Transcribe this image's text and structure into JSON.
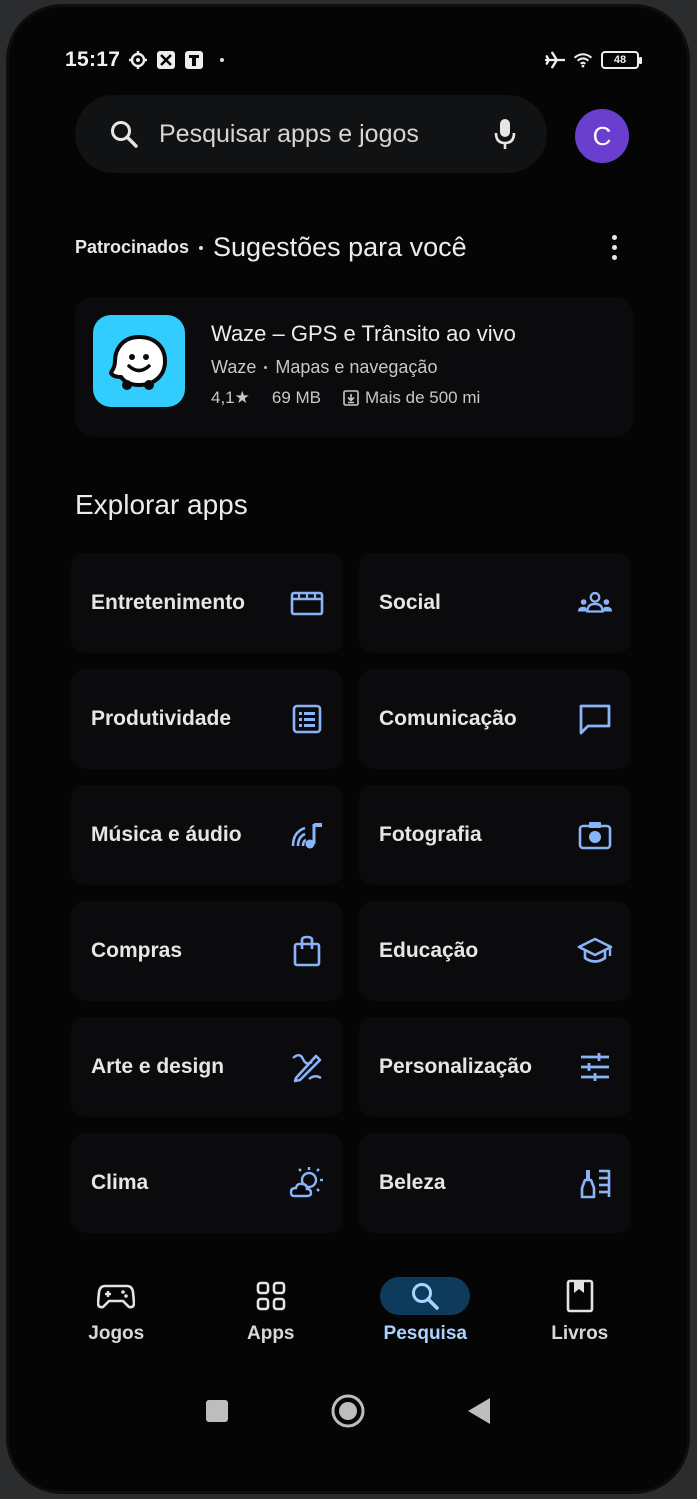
{
  "status_bar": {
    "time": "15:17",
    "battery": "48",
    "icons": [
      "settings-icon",
      "app-notification-icon",
      "app-notification-icon",
      "airplane-mode-icon",
      "wifi-icon",
      "battery-icon"
    ]
  },
  "search": {
    "placeholder": "Pesquisar apps e jogos",
    "search_icon": "search-icon",
    "mic_icon": "mic-icon"
  },
  "account": {
    "initial": "C",
    "color": "#6a3fd0"
  },
  "suggestions": {
    "sponsored_label": "Patrocinados",
    "title": "Sugestões para você",
    "app": {
      "name": "Waze – GPS e Trânsito ao vivo",
      "developer": "Waze",
      "category": "Mapas e navegação",
      "rating": "4,1★",
      "size": "69 MB",
      "downloads": "Mais de 500 mi",
      "icon_color": "#33ccff"
    }
  },
  "explore": {
    "title": "Explorar apps",
    "categories": [
      {
        "label": "Entretenimento",
        "icon": "clapperboard-icon"
      },
      {
        "label": "Social",
        "icon": "people-icon"
      },
      {
        "label": "Produtividade",
        "icon": "list-icon"
      },
      {
        "label": "Comunicação",
        "icon": "chat-icon"
      },
      {
        "label": "Música e áudio",
        "icon": "music-note-icon"
      },
      {
        "label": "Fotografia",
        "icon": "camera-icon"
      },
      {
        "label": "Compras",
        "icon": "shopping-bag-icon"
      },
      {
        "label": "Educação",
        "icon": "graduation-cap-icon"
      },
      {
        "label": "Arte e design",
        "icon": "brush-icon"
      },
      {
        "label": "Personalização",
        "icon": "sliders-icon"
      },
      {
        "label": "Clima",
        "icon": "weather-icon"
      },
      {
        "label": "Beleza",
        "icon": "beauty-icon"
      }
    ]
  },
  "bottom_nav": {
    "items": [
      {
        "label": "Jogos",
        "icon": "gamepad-icon"
      },
      {
        "label": "Apps",
        "icon": "apps-grid-icon"
      },
      {
        "label": "Pesquisa",
        "icon": "search-icon",
        "active": true
      },
      {
        "label": "Livros",
        "icon": "bookmark-book-icon"
      }
    ]
  },
  "colors": {
    "accent": "#8ab4f8",
    "active_pill": "#0e3a5c",
    "background": "#050506"
  }
}
